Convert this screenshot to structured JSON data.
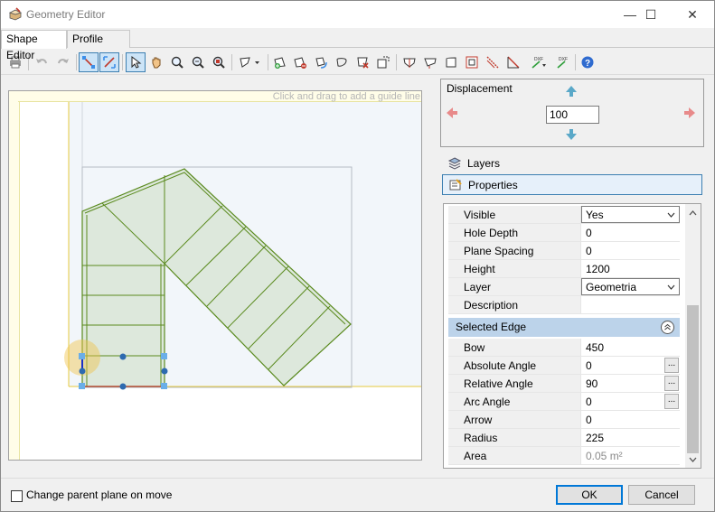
{
  "window": {
    "title": "Geometry Editor",
    "minimize": "—",
    "maximize": "☐",
    "close": "✕"
  },
  "tabs": [
    {
      "label": "Shape Editor",
      "active": true
    },
    {
      "label": "Profile Editor",
      "active": false
    }
  ],
  "canvas": {
    "guide_hint": "Click and drag to add a guide line"
  },
  "displacement": {
    "title": "Displacement",
    "value": "100"
  },
  "panels": {
    "layers": "Layers",
    "properties": "Properties"
  },
  "properties": {
    "rows": [
      {
        "label": "Visible",
        "value": "Yes",
        "type": "combo"
      },
      {
        "label": "Hole Depth",
        "value": "0"
      },
      {
        "label": "Plane Spacing",
        "value": "0"
      },
      {
        "label": "Height",
        "value": "1200"
      },
      {
        "label": "Layer",
        "value": "Geometria",
        "type": "combo"
      },
      {
        "label": "Description",
        "value": ""
      }
    ],
    "section": "Selected Edge",
    "edge_rows": [
      {
        "label": "Bow",
        "value": "450"
      },
      {
        "label": "Absolute Angle",
        "value": "0",
        "ellipsis": true
      },
      {
        "label": "Relative Angle",
        "value": "90",
        "ellipsis": true
      },
      {
        "label": "Arc Angle",
        "value": "0",
        "ellipsis": true
      },
      {
        "label": "Arrow",
        "value": "0"
      },
      {
        "label": "Radius",
        "value": "225"
      },
      {
        "label": "Area",
        "value": "0.05 m²",
        "readonly": true
      }
    ],
    "ellipsis": "..."
  },
  "footer": {
    "checkbox_label": "Change parent plane on move",
    "ok": "OK",
    "cancel": "Cancel"
  },
  "colors": {
    "accent": "#0078d7",
    "shape_stroke": "#5a8a1e",
    "shape_fill": "#dde8dc",
    "selection": "#3c8ee8",
    "guide": "#e6c83c"
  }
}
